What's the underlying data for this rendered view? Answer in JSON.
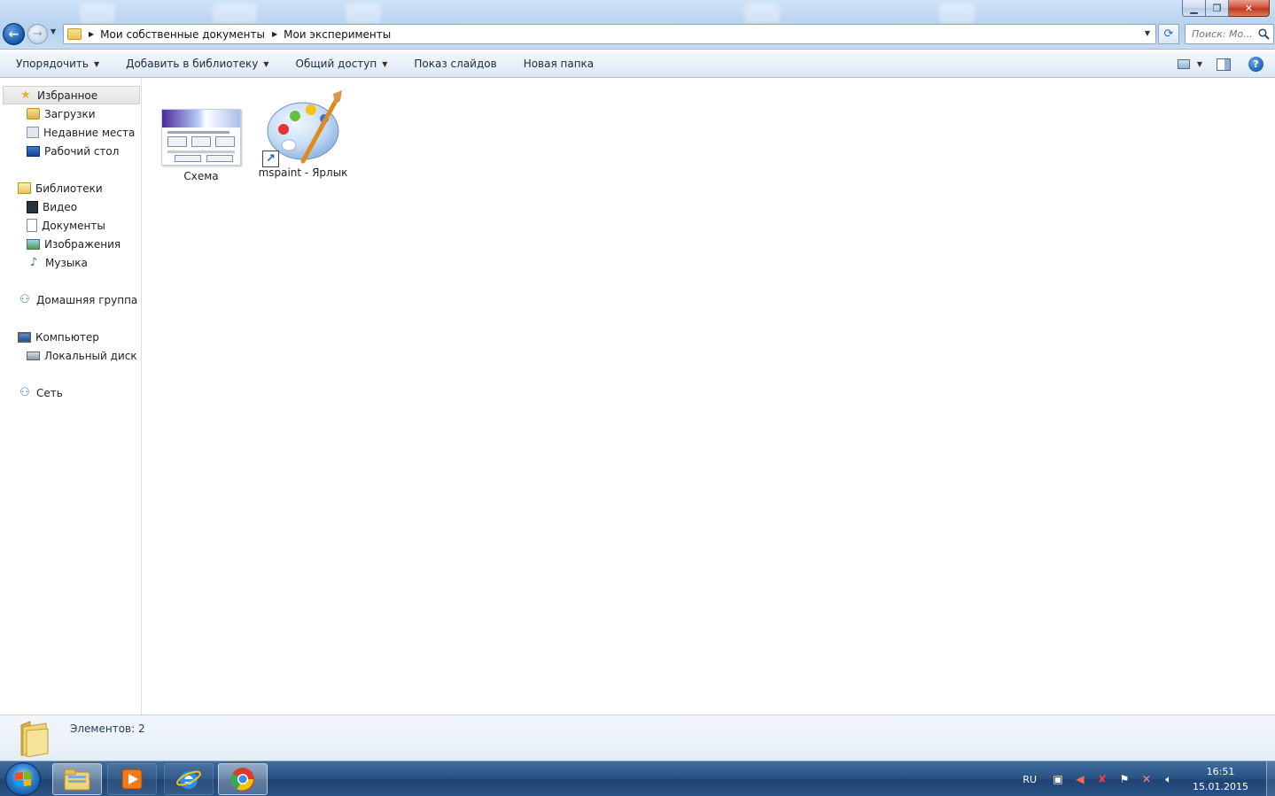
{
  "address_bar": {
    "breadcrumbs": [
      "Мои собственные документы",
      "Мои эксперименты"
    ]
  },
  "search": {
    "placeholder": "Поиск: Мо..."
  },
  "toolbar": {
    "organize": "Упорядочить",
    "add_to_library": "Добавить в библиотеку",
    "share": "Общий доступ",
    "slideshow": "Показ слайдов",
    "new_folder": "Новая папка"
  },
  "navigation": {
    "favorites": {
      "label": "Избранное",
      "items": [
        "Загрузки",
        "Недавние места",
        "Рабочий стол"
      ]
    },
    "libraries": {
      "label": "Библиотеки",
      "items": [
        "Видео",
        "Документы",
        "Изображения",
        "Музыка"
      ]
    },
    "homegroup": {
      "label": "Домашняя группа"
    },
    "computer": {
      "label": "Компьютер",
      "items": [
        "Локальный диск (C:)"
      ]
    },
    "network": {
      "label": "Сеть"
    }
  },
  "files": [
    {
      "name": "Схема",
      "type": "image",
      "thumb_title": "Общая структурная схема компьютера"
    },
    {
      "name": "mspaint - Ярлык",
      "type": "shortcut"
    }
  ],
  "details": {
    "count": "Элементов: 2"
  },
  "tray": {
    "language": "RU",
    "time": "16:51",
    "date": "15.01.2015"
  },
  "colors": {
    "accent": "#1e5fb2",
    "taskbar": "#2b5486",
    "toolbar": "#e9f0f9"
  }
}
